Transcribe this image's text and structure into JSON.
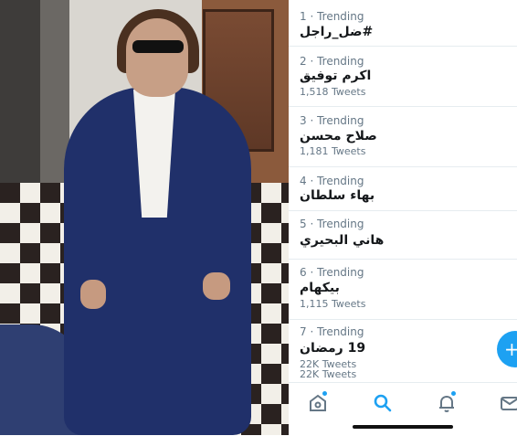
{
  "trends": [
    {
      "meta": "1 · Trending",
      "title": "#ضل_راجل",
      "count": ""
    },
    {
      "meta": "2 · Trending",
      "title": "اكرم توفيق",
      "count": "1,518 Tweets"
    },
    {
      "meta": "3 · Trending",
      "title": "صلاح محسن",
      "count": "1,181 Tweets"
    },
    {
      "meta": "4 · Trending",
      "title": "بهاء سلطان",
      "count": ""
    },
    {
      "meta": "5 · Trending",
      "title": "هاني البحيري",
      "count": ""
    },
    {
      "meta": "6 · Trending",
      "title": "بيكهام",
      "count": "1,115 Tweets"
    },
    {
      "meta": "7 · Trending",
      "title": "19 رمضان",
      "count": "22K Tweets",
      "count2": "22K Tweets"
    }
  ],
  "fab": {
    "icon": "+"
  },
  "tabs": [
    "home-icon",
    "search-icon",
    "notifications-icon",
    "messages-icon"
  ],
  "colors": {
    "accent": "#1da1f2",
    "text": "#14171a",
    "secondary": "#657786"
  }
}
